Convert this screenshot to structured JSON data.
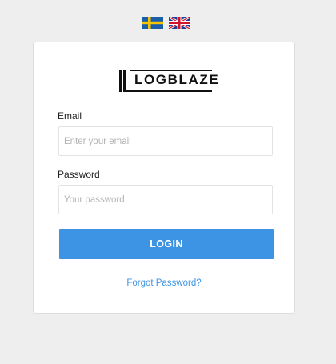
{
  "language_switcher": {
    "flags": [
      {
        "icon": "sweden-flag-icon",
        "colors": {
          "blue": "#1a5da8",
          "yellow": "#f5c400"
        }
      },
      {
        "icon": "uk-flag-icon",
        "colors": {
          "blue": "#1c3f94",
          "red": "#cf142b",
          "white": "#ffffff"
        }
      }
    ]
  },
  "logo": {
    "text": "LOGBLAZE",
    "icon": "logblaze-logo-mark"
  },
  "form": {
    "email_label": "Email",
    "email_placeholder": "Enter your email",
    "email_value": "",
    "password_label": "Password",
    "password_placeholder": "Your password",
    "password_value": "",
    "login_label": "LOGIN",
    "forgot_label": "Forgot Password?"
  },
  "colors": {
    "accent": "#3e94e4",
    "background": "#eeeeee",
    "card": "#ffffff"
  }
}
